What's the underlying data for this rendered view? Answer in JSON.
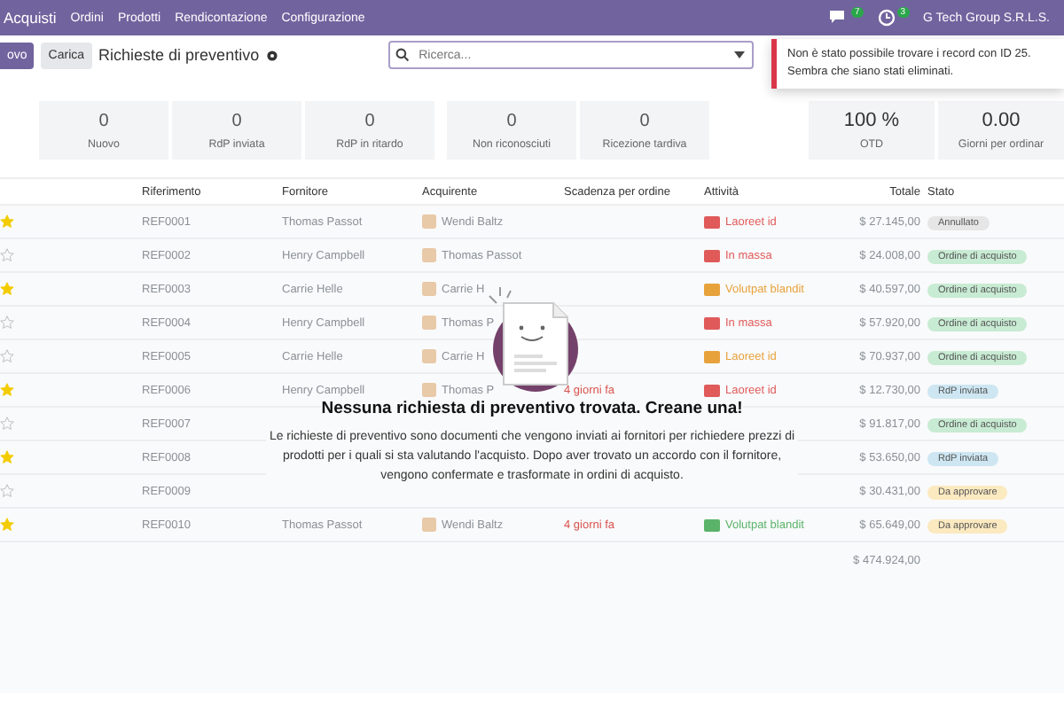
{
  "navbar": {
    "app": "Acquisti",
    "menu": [
      "Ordini",
      "Prodotti",
      "Rendicontazione",
      "Configurazione"
    ],
    "messages_badge": "7",
    "activities_badge": "3",
    "company": "G Tech Group S.R.L.S."
  },
  "control_bar": {
    "new_button": "ovo",
    "upload_button": "Carica",
    "title": "Richieste di preventivo",
    "search": {
      "placeholder": "Ricerca..."
    }
  },
  "toast": {
    "message": "Non è stato possibile trovare i record con ID 25. Sembra che siano stati eliminati."
  },
  "kpis": [
    {
      "value": "0",
      "label": "Nuovo"
    },
    {
      "value": "0",
      "label": "RdP inviata"
    },
    {
      "value": "0",
      "label": "RdP in ritardo"
    },
    {
      "value": "0",
      "label": "Non riconosciuti"
    },
    {
      "value": "0",
      "label": "Ricezione tardiva"
    }
  ],
  "kpis_right": [
    {
      "value": "100 %",
      "label": "OTD"
    },
    {
      "value": "0.00",
      "label": "Giorni per ordinar"
    }
  ],
  "table": {
    "columns": [
      "Riferimento",
      "Fornitore",
      "Acquirente",
      "Scadenza per ordine",
      "Attività",
      "Totale",
      "Stato"
    ],
    "rows": [
      {
        "starred": true,
        "ref": "REF0001",
        "supplier": "Thomas Passot",
        "buyer": "Wendi Baltz",
        "activity": {
          "label": "Laoreet id",
          "color": "#e05a5a"
        },
        "total": "$ 27.145,00",
        "status": {
          "label": "Annullato",
          "color": "#e6e6e6"
        }
      },
      {
        "starred": false,
        "ref": "REF0002",
        "supplier": "Henry Campbell",
        "buyer": "Thomas Passot",
        "activity": {
          "label": "In massa",
          "color": "#e05a5a"
        },
        "total": "$ 24.008,00",
        "status": {
          "label": "Ordine di acquisto",
          "color": "#c8ebd3"
        }
      },
      {
        "starred": true,
        "ref": "REF0003",
        "supplier": "Carrie Helle",
        "buyer": "Carrie H",
        "activity": {
          "label": "Volutpat blandit",
          "color": "#e8a23c"
        },
        "total": "$ 40.597,00",
        "status": {
          "label": "Ordine di acquisto",
          "color": "#c8ebd3"
        }
      },
      {
        "starred": false,
        "ref": "REF0004",
        "supplier": "Henry Campbell",
        "buyer": "Thomas P",
        "activity": {
          "label": "In massa",
          "color": "#e05a5a"
        },
        "total": "$ 57.920,00",
        "status": {
          "label": "Ordine di acquisto",
          "color": "#c8ebd3"
        }
      },
      {
        "starred": false,
        "ref": "REF0005",
        "supplier": "Carrie Helle",
        "buyer": "Carrie H",
        "activity": {
          "label": "Laoreet id",
          "color": "#e8a23c"
        },
        "total": "$ 70.937,00",
        "status": {
          "label": "Ordine di acquisto",
          "color": "#c8ebd3"
        }
      },
      {
        "starred": true,
        "ref": "REF0006",
        "supplier": "Henry Campbell",
        "buyer": "Thomas P",
        "deadline": "4 giorni fa",
        "activity": {
          "label": "Laoreet id",
          "color": "#e05a5a"
        },
        "total": "$ 12.730,00",
        "status": {
          "label": "RdP inviata",
          "color": "#cde6f2"
        }
      },
      {
        "starred": false,
        "ref": "REF0007",
        "total": "$ 91.817,00",
        "status": {
          "label": "Ordine di acquisto",
          "color": "#c8ebd3"
        }
      },
      {
        "starred": true,
        "ref": "REF0008",
        "total": "$ 53.650,00",
        "status": {
          "label": "RdP inviata",
          "color": "#cde6f2"
        }
      },
      {
        "starred": false,
        "ref": "REF0009",
        "total": "$ 30.431,00",
        "status": {
          "label": "Da approvare",
          "color": "#fbe9c0"
        }
      },
      {
        "starred": true,
        "ref": "REF0010",
        "supplier": "Thomas Passot",
        "buyer": "Wendi Baltz",
        "deadline": "4 giorni fa",
        "activity": {
          "label": "Volutpat blandit",
          "color": "#5bb36a"
        },
        "total": "$ 65.649,00",
        "status": {
          "label": "Da approvare",
          "color": "#fbe9c0"
        }
      }
    ],
    "grand_total": "$ 474.924,00"
  },
  "empty_state": {
    "title": "Nessuna richiesta di preventivo trovata. Creane una!",
    "text": "Le richieste di preventivo sono documenti che vengono inviati ai fornitori per richiedere prezzi di prodotti per i quali si sta valutando l'acquisto. Dopo aver trovato un accordo con il fornitore, vengono confermate e trasformate in ordini di acquisto."
  }
}
